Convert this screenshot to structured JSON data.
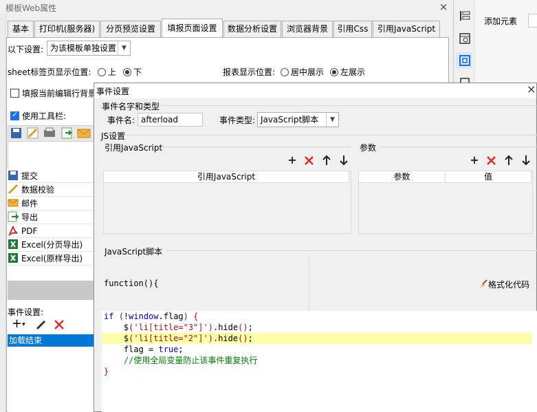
{
  "outer_window": {
    "title": "模板Web属性",
    "close": "×",
    "tabs": [
      {
        "label": "基本",
        "active": false
      },
      {
        "label": "打印机(服务器)",
        "active": false
      },
      {
        "label": "分页预览设置",
        "active": false
      },
      {
        "label": "填报页面设置",
        "active": true
      },
      {
        "label": "数据分析设置",
        "active": false
      },
      {
        "label": "浏览器背景",
        "active": false
      },
      {
        "label": "引用Css",
        "active": false
      },
      {
        "label": "引用JavaScript",
        "active": false
      }
    ],
    "settings_label": "以下设置:",
    "settings_value": "为该模板单独设置",
    "sheet_tab_label": "sheet标签页显示位置:",
    "sheet_tab_options": [
      "上",
      "下"
    ],
    "report_pos_label": "报表显示位置:",
    "report_pos_options": [
      "居中展示",
      "左展示"
    ],
    "highlight_row_label": "填报当前编辑行背景",
    "use_toolbar_label": "使用工具栏:",
    "toolbar_items": [
      {
        "label": "提交",
        "icon": "submit-icon"
      },
      {
        "label": "数据校验",
        "icon": "pencil-check-icon"
      },
      {
        "label": "邮件",
        "icon": "mail-icon"
      },
      {
        "label": "导出",
        "icon": "export-icon"
      },
      {
        "label": "PDF",
        "icon": "pdf-icon"
      },
      {
        "label": "Excel(分页导出)",
        "icon": "excel-icon"
      },
      {
        "label": "Excel(原样导出)",
        "icon": "excel-icon"
      }
    ],
    "event_settings_label": "事件设置:",
    "event_item": "加载结束"
  },
  "right_panel": {
    "add_element_label": "添加元素"
  },
  "dialog": {
    "title": "事件设置",
    "close": "×",
    "name_type_group": "事件名字和类型",
    "event_name_label": "事件名:",
    "event_name_value": "afterload",
    "event_type_label": "事件类型:",
    "event_type_value": "JavaScript脚本",
    "js_group": "JS设置",
    "ref_js_label": "引用JavaScript",
    "ref_js_column": "引用JavaScript",
    "params_label": "参数",
    "params_columns": [
      "参数",
      "值"
    ],
    "script_label": "JavaScript脚本",
    "function_header": "function(){",
    "format_code_label": "格式化代码",
    "code_lines": [
      "if (!window.flag) {",
      "    $('li[title=\"3\"]').hide();",
      "    $('li[title=\"2\"]').hide();",
      "    flag = true;",
      "    //使用全局变量防止该事件重复执行",
      "}"
    ],
    "highlighted_line": 2,
    "colors": {
      "keyword": "#0000cc",
      "string": "#aa1111",
      "comment": "#008000",
      "highlight": "#ffffaa"
    }
  }
}
